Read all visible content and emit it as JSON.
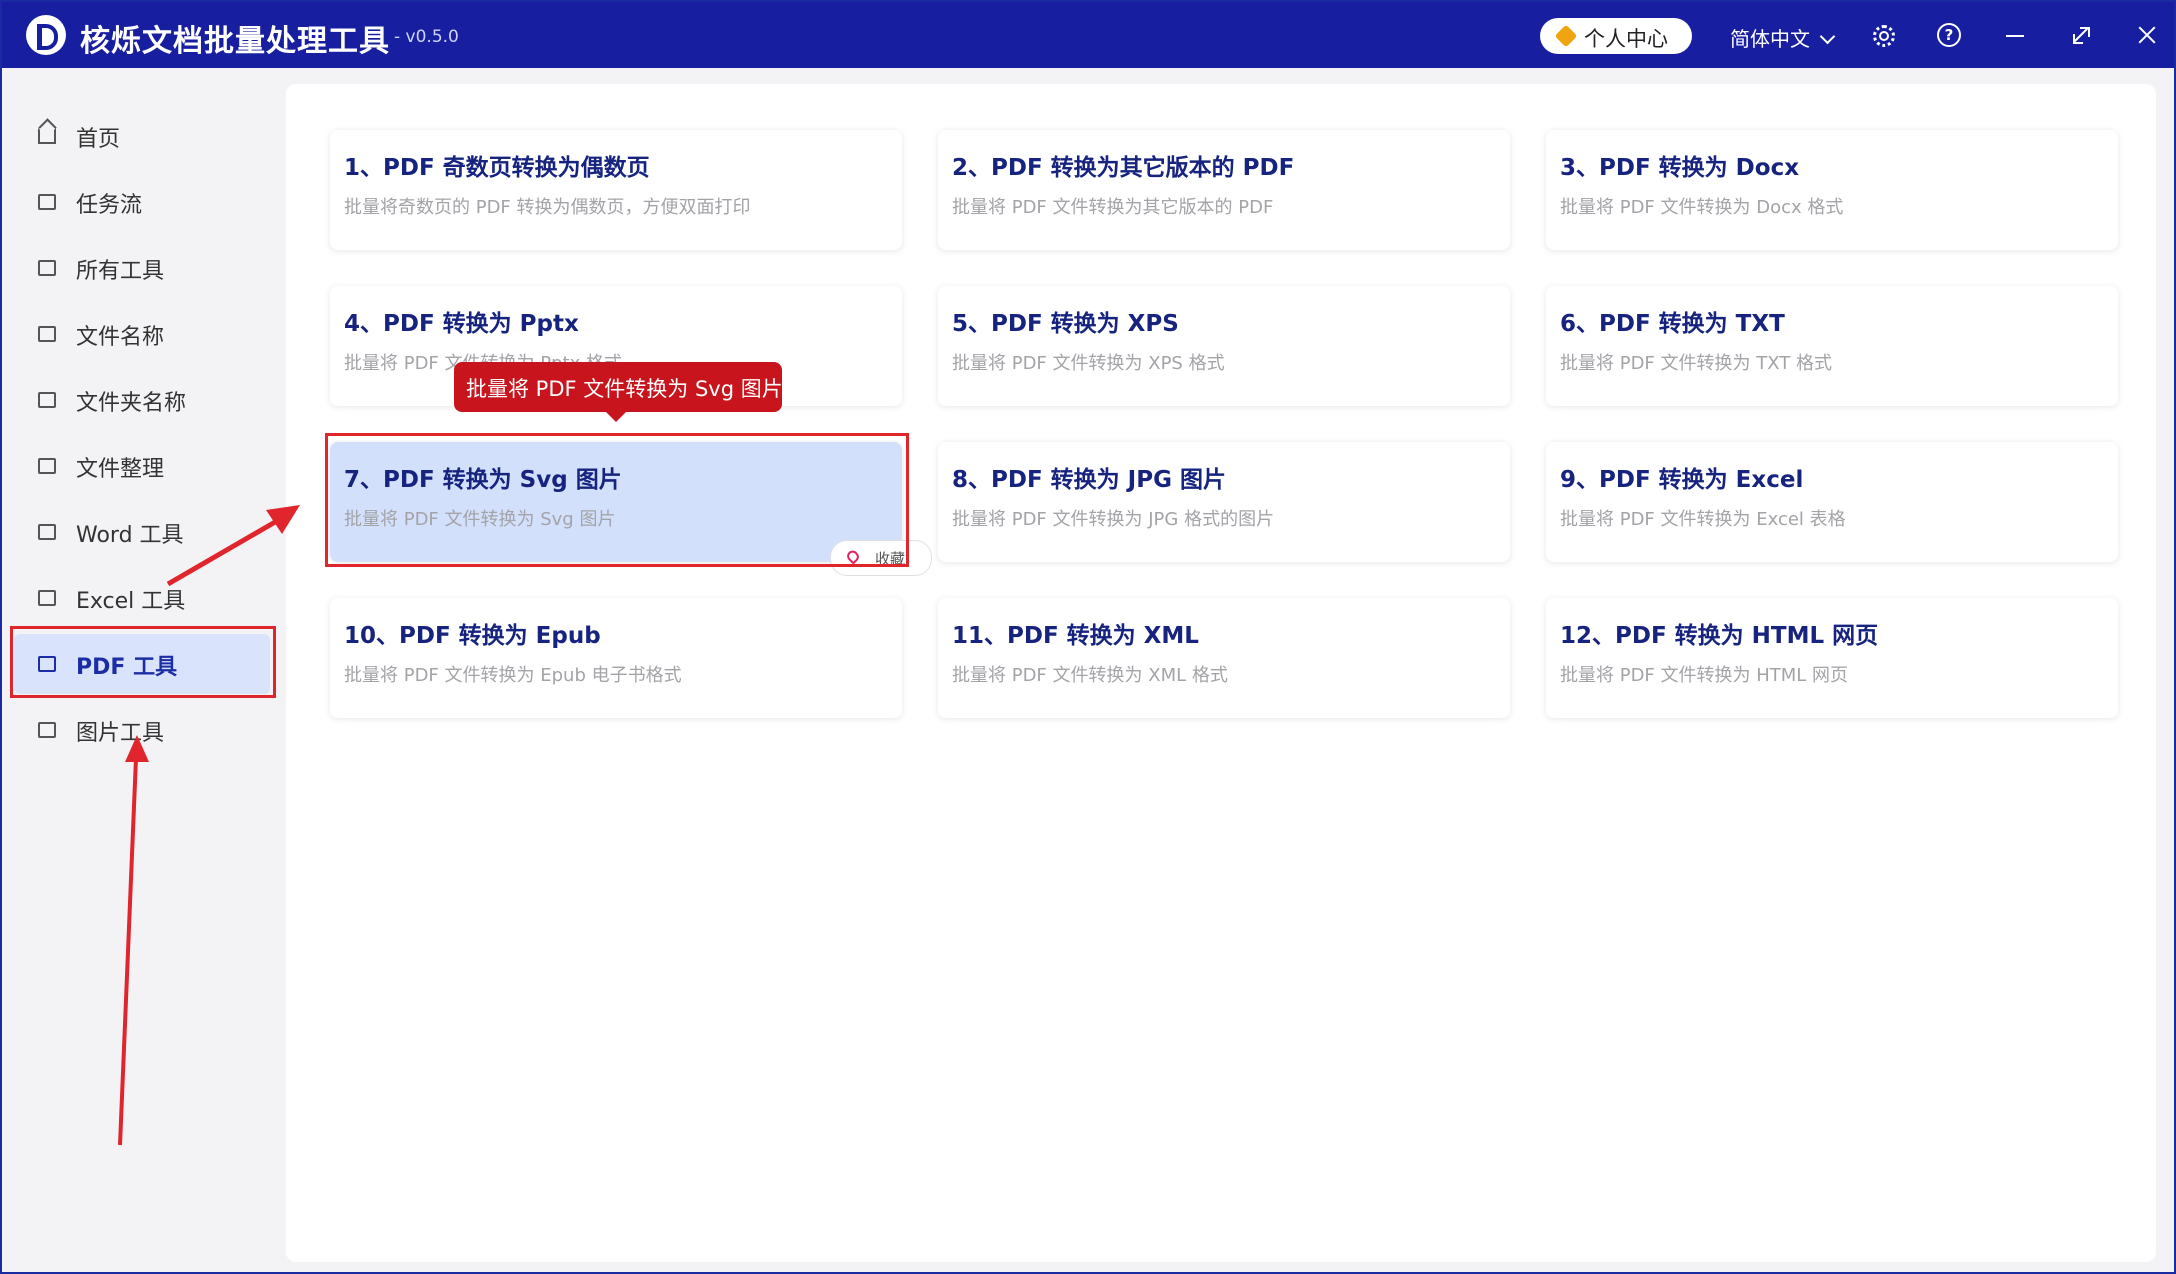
{
  "app": {
    "title": "核烁文档批量处理工具",
    "version": "- v0.5.0",
    "user_center": "个人中心",
    "language": "简体中文"
  },
  "sidebar": {
    "items": [
      {
        "label": "首页",
        "icon": "home-icon"
      },
      {
        "label": "任务流",
        "icon": "workflow-icon"
      },
      {
        "label": "所有工具",
        "icon": "monitor-icon"
      },
      {
        "label": "文件名称",
        "icon": "file-icon"
      },
      {
        "label": "文件夹名称",
        "icon": "folder-icon"
      },
      {
        "label": "文件整理",
        "icon": "organize-icon"
      },
      {
        "label": "Word 工具",
        "icon": "word-icon"
      },
      {
        "label": "Excel 工具",
        "icon": "excel-icon"
      },
      {
        "label": "PDF 工具",
        "icon": "pdf-icon"
      },
      {
        "label": "图片工具",
        "icon": "image-icon"
      }
    ],
    "active_index": 8
  },
  "cards": [
    {
      "title": "1、PDF 奇数页转换为偶数页",
      "desc": "批量将奇数页的 PDF 转换为偶数页，方便双面打印"
    },
    {
      "title": "2、PDF 转换为其它版本的 PDF",
      "desc": "批量将 PDF 文件转换为其它版本的 PDF"
    },
    {
      "title": "3、PDF 转换为 Docx",
      "desc": "批量将 PDF 文件转换为 Docx 格式"
    },
    {
      "title": "4、PDF 转换为 Pptx",
      "desc": "批量将 PDF 文件转换为 Pptx 格式"
    },
    {
      "title": "5、PDF 转换为 XPS",
      "desc": "批量将 PDF 文件转换为 XPS 格式"
    },
    {
      "title": "6、PDF 转换为 TXT",
      "desc": "批量将 PDF 文件转换为 TXT 格式"
    },
    {
      "title": "7、PDF 转换为 Svg 图片",
      "desc": "批量将 PDF 文件转换为 Svg 图片"
    },
    {
      "title": "8、PDF 转换为 JPG 图片",
      "desc": "批量将 PDF 文件转换为 JPG 格式的图片"
    },
    {
      "title": "9、PDF 转换为 Excel",
      "desc": "批量将 PDF 文件转换为 Excel 表格"
    },
    {
      "title": "10、PDF 转换为 Epub",
      "desc": "批量将 PDF 文件转换为 Epub 电子书格式"
    },
    {
      "title": "11、PDF 转换为 XML",
      "desc": "批量将 PDF 文件转换为 XML 格式"
    },
    {
      "title": "12、PDF 转换为 HTML 网页",
      "desc": "批量将 PDF 文件转换为 HTML 网页"
    }
  ],
  "selected_card_index": 6,
  "tooltip": "批量将 PDF 文件转换为 Svg 图片",
  "favorite_label": "收藏",
  "colors": {
    "titlebar": "#171fa0",
    "accent": "#1b2ea6",
    "annotation_red": "#e0252c",
    "tooltip_red": "#c8151d",
    "selected_card": "#d3e0fb"
  }
}
